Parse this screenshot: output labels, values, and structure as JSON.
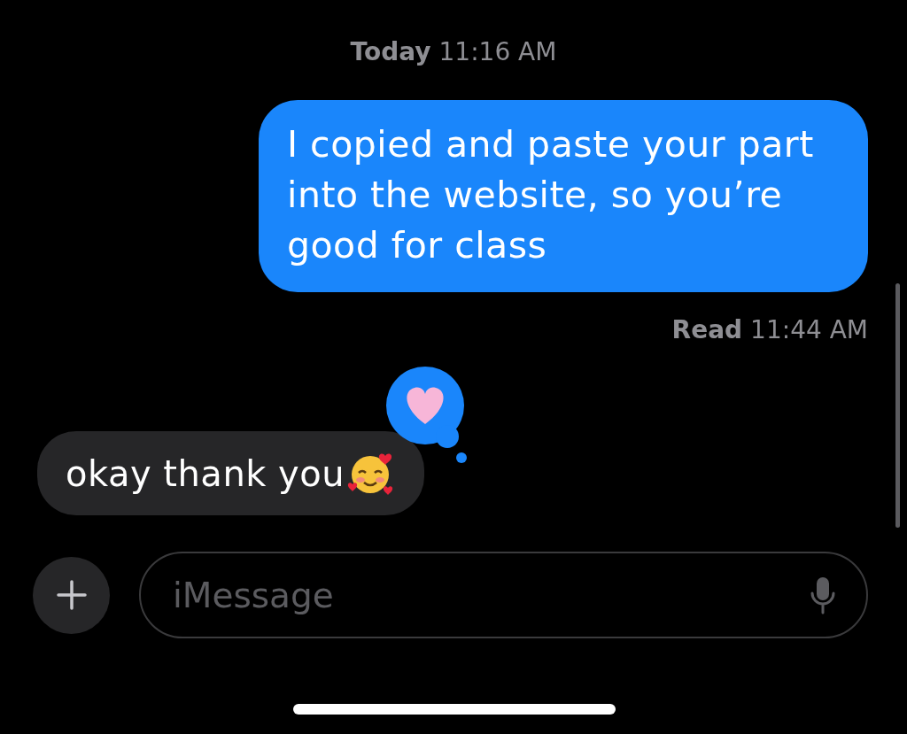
{
  "timestamp": {
    "day": "Today",
    "time": "11:16 AM"
  },
  "messages": [
    {
      "kind": "sent",
      "text": "I copied and paste your part into the website, so you’re good for class",
      "receipt": {
        "label": "Read",
        "time": "11:44 AM"
      }
    },
    {
      "kind": "received",
      "text": "okay thank you",
      "emoji": true,
      "tapback": true
    }
  ],
  "composer": {
    "placeholder": "iMessage"
  }
}
